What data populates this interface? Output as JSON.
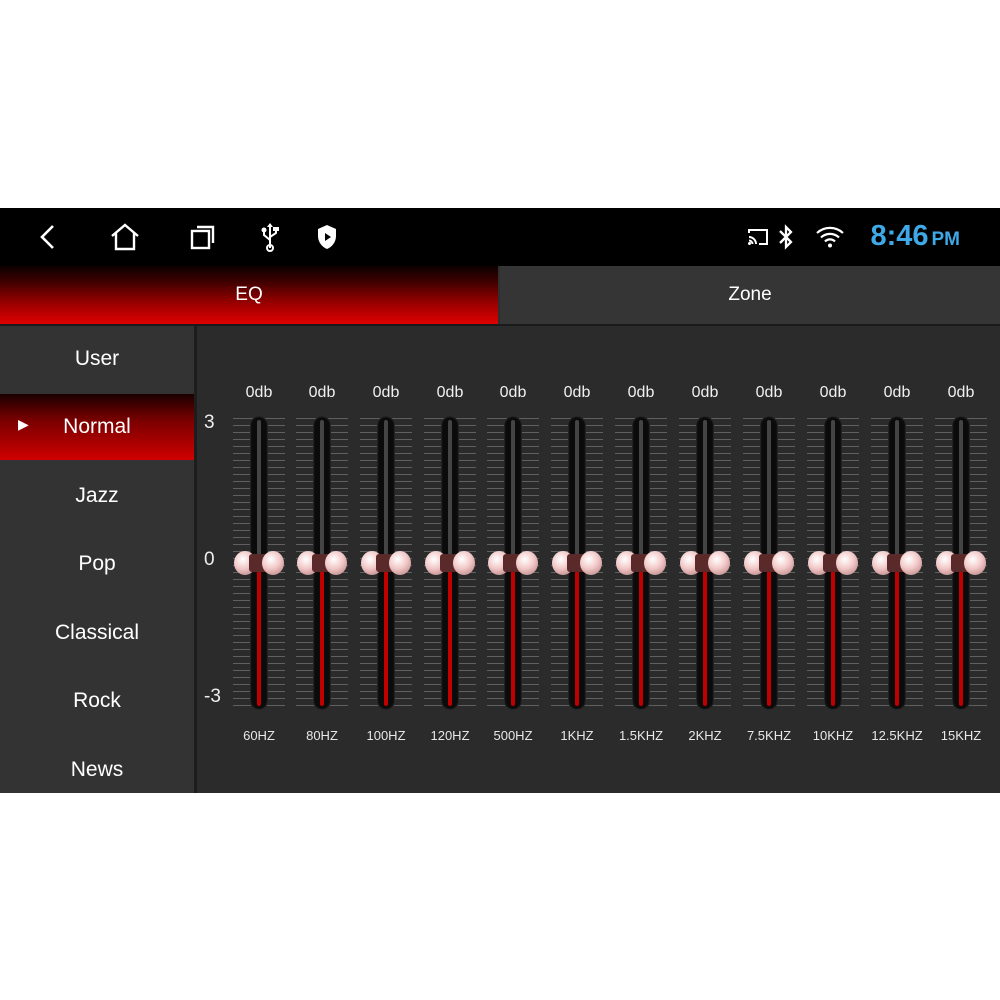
{
  "status_bar": {
    "icons": [
      "back-icon",
      "home-icon",
      "recents-icon",
      "usb-icon",
      "shield-icon",
      "cast-icon",
      "bluetooth-icon",
      "wifi-icon"
    ],
    "time": "8:46",
    "ampm": "PM",
    "clock_color": "#3fa9e8"
  },
  "tabs": [
    {
      "label": "EQ",
      "active": true
    },
    {
      "label": "Zone",
      "active": false
    }
  ],
  "presets": [
    {
      "label": "User"
    },
    {
      "label": "Normal",
      "active": true,
      "marker": "▶"
    },
    {
      "label": "Jazz"
    },
    {
      "label": "Pop"
    },
    {
      "label": "Classical"
    },
    {
      "label": "Rock"
    },
    {
      "label": "News"
    }
  ],
  "scale": {
    "max": "3",
    "mid": "0",
    "min": "-3"
  },
  "bands": [
    {
      "freq": "60HZ",
      "db_label": "0db",
      "gain": 0
    },
    {
      "freq": "80HZ",
      "db_label": "0db",
      "gain": 0
    },
    {
      "freq": "100HZ",
      "db_label": "0db",
      "gain": 0
    },
    {
      "freq": "120HZ",
      "db_label": "0db",
      "gain": 0
    },
    {
      "freq": "500HZ",
      "db_label": "0db",
      "gain": 0
    },
    {
      "freq": "1KHZ",
      "db_label": "0db",
      "gain": 0
    },
    {
      "freq": "1.5KHZ",
      "db_label": "0db",
      "gain": 0
    },
    {
      "freq": "2KHZ",
      "db_label": "0db",
      "gain": 0
    },
    {
      "freq": "7.5KHZ",
      "db_label": "0db",
      "gain": 0
    },
    {
      "freq": "10KHZ",
      "db_label": "0db",
      "gain": 0
    },
    {
      "freq": "12.5KHZ",
      "db_label": "0db",
      "gain": 0
    },
    {
      "freq": "15KHZ",
      "db_label": "0db",
      "gain": 0
    }
  ],
  "colors": {
    "accent": "#d00000",
    "background": "#2b2b2b"
  }
}
